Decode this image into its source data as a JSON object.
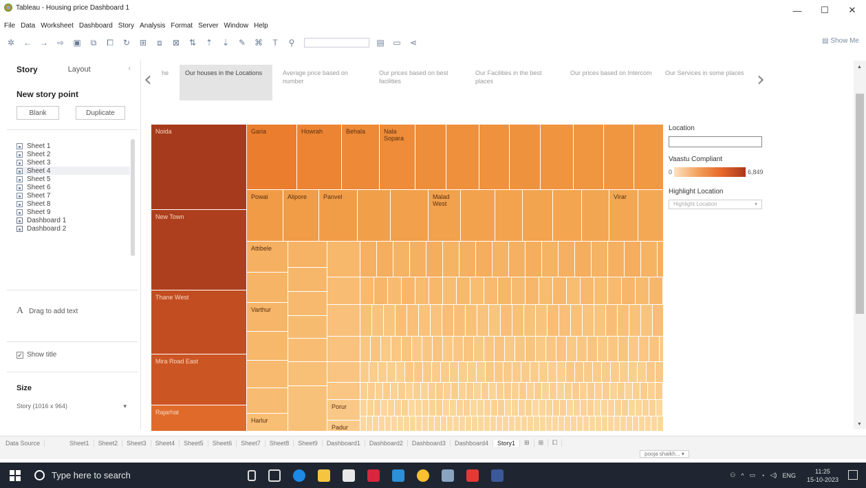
{
  "window": {
    "title": "Tableau - Housing price Dashboard 1",
    "controls": [
      "—",
      "☐",
      "✕"
    ]
  },
  "menu": [
    "File",
    "Data",
    "Worksheet",
    "Dashboard",
    "Story",
    "Analysis",
    "Format",
    "Server",
    "Window",
    "Help"
  ],
  "toolbar": {
    "show_me": "Show Me"
  },
  "left_pane": {
    "tab_story": "Story",
    "tab_layout": "Layout",
    "section_title": "New story point",
    "btn_blank": "Blank",
    "btn_duplicate": "Duplicate",
    "sheets": [
      "Sheet 1",
      "Sheet 2",
      "Sheet 3",
      "Sheet 4",
      "Sheet 5",
      "Sheet 6",
      "Sheet 7",
      "Sheet 8",
      "Sheet 9",
      "Dashboard 1",
      "Dashboard 2"
    ],
    "drag_text": "Drag to add text",
    "show_title": "Show title",
    "size_title": "Size",
    "size_value": "Story (1016 x 964)"
  },
  "story_points": [
    {
      "label": "he"
    },
    {
      "label": "Our houses in the Locations",
      "active": true
    },
    {
      "label": "Average price based on number"
    },
    {
      "label": "Our prices based on best facilities"
    },
    {
      "label": "Our Facilities in the best places"
    },
    {
      "label": "Our prices based on Intercom"
    },
    {
      "label": "Our Services in some places"
    }
  ],
  "treemap_labels": {
    "noida": "Noida",
    "new_town": "New Town",
    "thane_west": "Thane West",
    "mira_road": "Mira Road East",
    "rajarhat": "Rajarhat",
    "garia": "Garia",
    "howrah": "Howrah",
    "behala": "Behala",
    "nala_sopara": "Nala Sopara",
    "powai": "Powai",
    "alipore": "Alipore",
    "panvel": "Panvel",
    "malad_west": "Malad West",
    "virar": "Virar",
    "attibele": "Attibele",
    "varthur": "Varthur",
    "porur": "Porur",
    "harlur": "Harlur",
    "padur": "Padur"
  },
  "legend": {
    "location_title": "Location",
    "vaastu_title": "Vaastu Compliant",
    "min": "0",
    "max": "6,849",
    "highlight_title": "Highlight Location",
    "highlight_placeholder": "Highlight Location"
  },
  "bottom_tabs": [
    "Data Source",
    "Sheet1",
    "Sheet2",
    "Sheet3",
    "Sheet4",
    "Sheet5",
    "Sheet6",
    "Sheet7",
    "Sheet8",
    "Sheet9",
    "Dashboard1",
    "Dashboard2",
    "Dashboard3",
    "Dashboard4",
    "Story1"
  ],
  "status": {
    "user": "pooja shaikh..."
  },
  "taskbar": {
    "search": "Type here to search",
    "lang": "ENG",
    "time": "11:25",
    "date": "15-10-2023"
  },
  "colors": {
    "treemap_dark": "#b0421f",
    "treemap_mid": "#e87a2d",
    "treemap_light": "#fcd29c"
  }
}
